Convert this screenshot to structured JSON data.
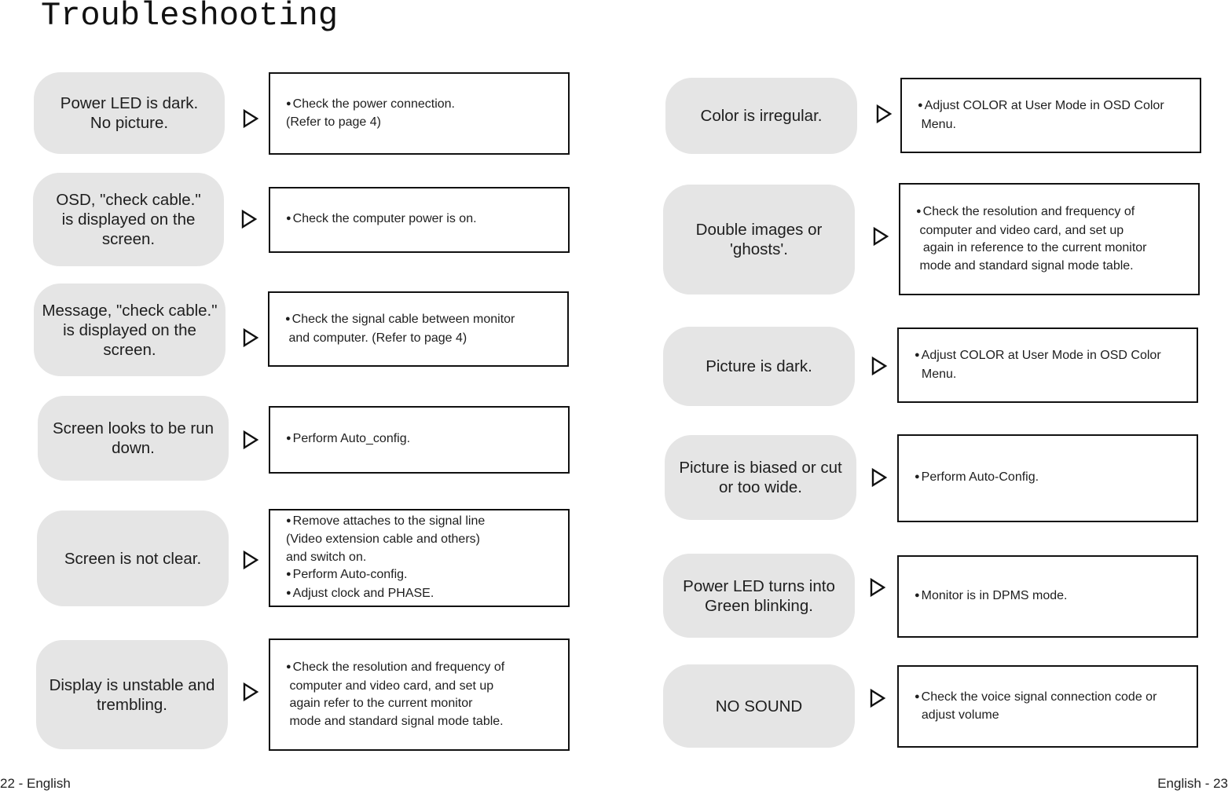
{
  "page_title": "Troubleshooting",
  "footer": {
    "left": "22 - English",
    "right": "English - 23"
  },
  "left_column": [
    {
      "symptom": "Power LED is dark.\nNo picture.",
      "solution": [
        {
          "bullet": true,
          "text": "Check the power connection."
        },
        {
          "bullet": false,
          "text": "(Refer to page 4)"
        }
      ]
    },
    {
      "symptom": "OSD, \"check cable.\"\nis displayed on the\nscreen.",
      "solution": [
        {
          "bullet": true,
          "text": "Check the computer power is on."
        }
      ]
    },
    {
      "symptom": "Message, \"check cable.\"\nis displayed on the\nscreen.",
      "solution": [
        {
          "bullet": true,
          "text": "Check the signal cable between monitor"
        },
        {
          "bullet": false,
          "text": " and computer. (Refer to page 4)"
        }
      ]
    },
    {
      "symptom": "Screen looks to be run\ndown.",
      "solution": [
        {
          "bullet": true,
          "text": "Perform Auto_config."
        }
      ]
    },
    {
      "symptom": "Screen is not clear.",
      "solution": [
        {
          "bullet": true,
          "text": "Remove attaches to the signal line"
        },
        {
          "bullet": false,
          "text": "(Video extension cable and others)"
        },
        {
          "bullet": false,
          "text": "and switch on."
        },
        {
          "bullet": true,
          "text": "Perform Auto-config."
        },
        {
          "bullet": true,
          "text": "Adjust clock and PHASE."
        }
      ]
    },
    {
      "symptom": "Display is unstable and\ntrembling.",
      "solution": [
        {
          "bullet": true,
          "text": "Check the resolution and frequency of"
        },
        {
          "bullet": false,
          "text": " computer and video card, and set up"
        },
        {
          "bullet": false,
          "text": " again refer to the current monitor"
        },
        {
          "bullet": false,
          "text": " mode and standard signal mode table."
        }
      ]
    }
  ],
  "right_column": [
    {
      "symptom": "Color is irregular.",
      "solution": [
        {
          "bullet": true,
          "text": "Adjust COLOR at User Mode in OSD Color"
        },
        {
          "bullet": false,
          "text": " Menu."
        }
      ]
    },
    {
      "symptom": "Double images or\n'ghosts'.",
      "solution": [
        {
          "bullet": true,
          "text": "Check the resolution and frequency of"
        },
        {
          "bullet": false,
          "text": " computer and video card, and set up"
        },
        {
          "bullet": false,
          "text": "  again in reference to the current monitor"
        },
        {
          "bullet": false,
          "text": " mode and standard signal mode table."
        }
      ]
    },
    {
      "symptom": "Picture is dark.",
      "solution": [
        {
          "bullet": true,
          "text": "Adjust COLOR at User Mode in OSD Color"
        },
        {
          "bullet": false,
          "text": "  Menu."
        }
      ]
    },
    {
      "symptom": "Picture is biased or cut\nor too wide.",
      "solution": [
        {
          "bullet": true,
          "text": "Perform Auto-Config."
        }
      ]
    },
    {
      "symptom": "Power LED turns into\nGreen blinking.",
      "solution": [
        {
          "bullet": true,
          "text": "Monitor is in DPMS mode."
        }
      ]
    },
    {
      "symptom": "NO SOUND",
      "solution": [
        {
          "bullet": true,
          "text": "Check the voice signal connection code or"
        },
        {
          "bullet": false,
          "text": "  adjust volume"
        }
      ]
    }
  ]
}
